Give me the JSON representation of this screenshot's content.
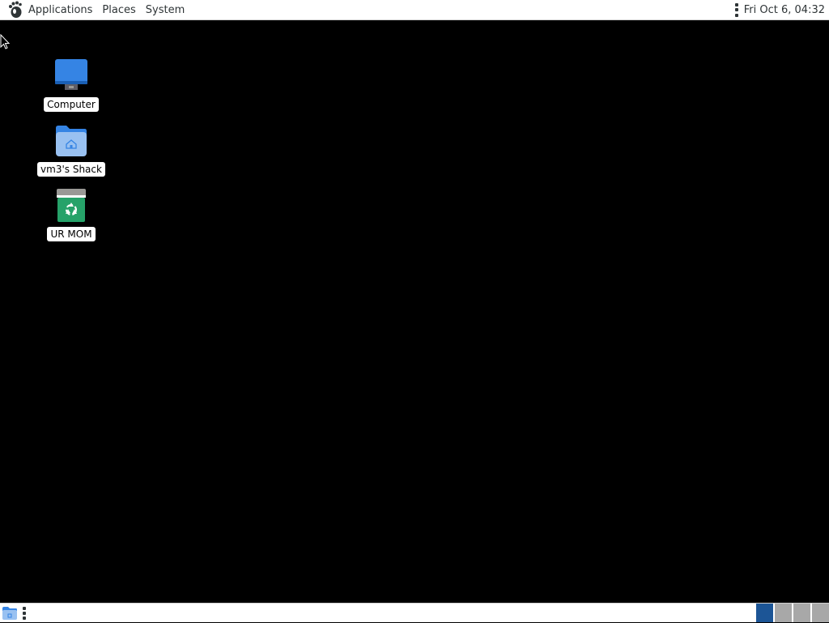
{
  "top_panel": {
    "menus": {
      "applications": "Applications",
      "places": "Places",
      "system": "System"
    },
    "clock": "Fri Oct  6, 04:32"
  },
  "desktop": {
    "icons": [
      {
        "label": "Computer",
        "icon": "computer-icon"
      },
      {
        "label": "vm3's Shack",
        "icon": "home-folder-icon"
      },
      {
        "label": "UR MOM",
        "icon": "trash-icon"
      }
    ]
  },
  "bottom_panel": {
    "workspaces": {
      "count": 4,
      "active_index": 0
    }
  },
  "colors": {
    "panel_bg": "#ffffff",
    "desktop_bg": "#000000",
    "active_workspace": "#1c5596",
    "inactive_workspace": "#a8a8a8",
    "computer_blue": "#3584e4",
    "folder_blue": "#62a0ea",
    "trash_green": "#26a269"
  }
}
